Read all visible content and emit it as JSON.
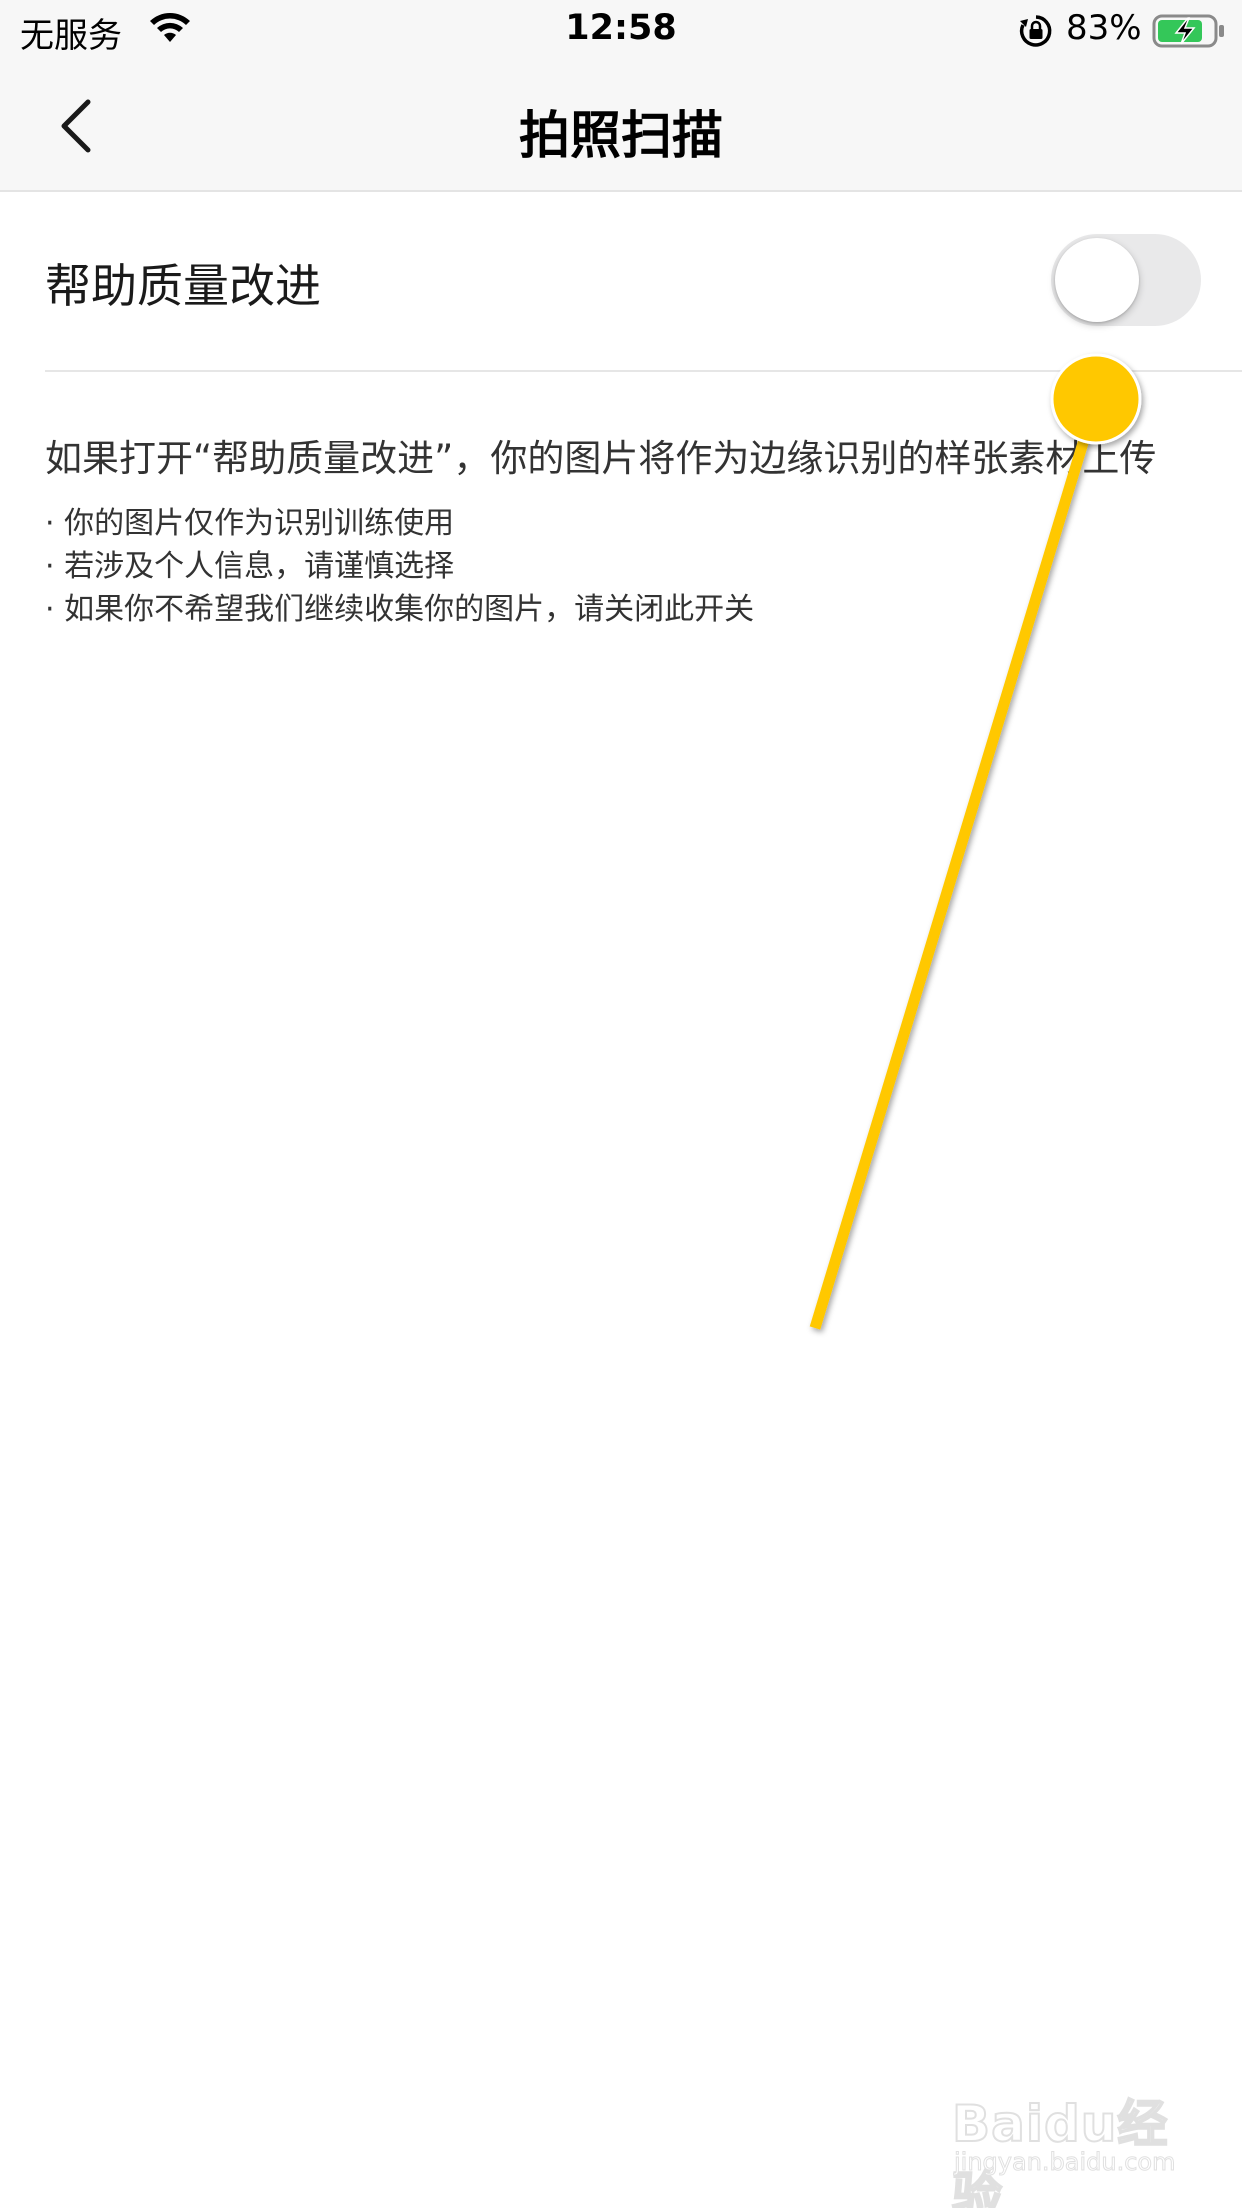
{
  "status_bar": {
    "carrier": "无服务",
    "time": "12:58",
    "battery_percent": "83%",
    "icons": [
      "wifi-icon",
      "orientation-lock-icon",
      "battery-charging-icon"
    ]
  },
  "nav": {
    "title": "拍照扫描",
    "back_icon": "chevron-left-icon"
  },
  "setting": {
    "label": "帮助质量改进",
    "toggle_on": false
  },
  "description": {
    "main": "如果打开“帮助质量改进”，你的图片将作为边缘识别的样张素材上传",
    "bullets": [
      "· 你的图片仅作为识别训练使用",
      "· 若涉及个人信息，请谨慎选择",
      "· 如果你不希望我们继续收集你的图片，请关闭此开关"
    ]
  },
  "annotation": {
    "color": "#FFC800"
  },
  "watermark": {
    "main": "Baidu经验",
    "sub": "jingyan.baidu.com"
  }
}
